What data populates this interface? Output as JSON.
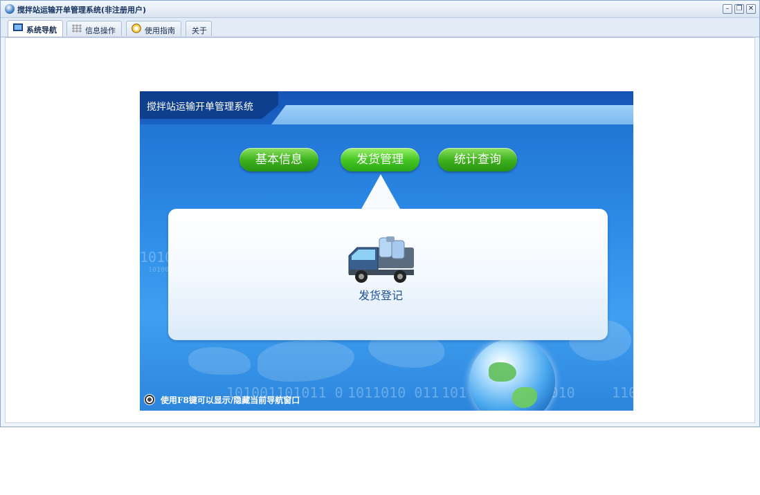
{
  "window": {
    "title": "搅拌站运输开单管理系统(非注册用户)",
    "controls": [
      "minimize",
      "restore",
      "close"
    ]
  },
  "tabs": [
    {
      "label": "系统导航",
      "icon": "monitor-icon",
      "active": true
    },
    {
      "label": "信息操作",
      "icon": "grid-icon",
      "active": false
    },
    {
      "label": "使用指南",
      "icon": "help-icon",
      "active": false
    },
    {
      "label": "关于",
      "icon": "",
      "active": false
    }
  ],
  "panel": {
    "system_title": "搅拌站运输开单管理系统",
    "menu": [
      {
        "label": "基本信息",
        "selected": false
      },
      {
        "label": "发货管理",
        "selected": true
      },
      {
        "label": "统计查询",
        "selected": false
      }
    ],
    "items": [
      {
        "label": "发货登记",
        "icon": "truck-icon"
      }
    ],
    "hint": "使用F8键可以显示/隐藏当前导航窗口",
    "decor_binary": [
      "1010",
      "10100",
      "101001101011 0",
      "1011010 011",
      "101 0110101 1010",
      "110"
    ]
  },
  "colors": {
    "accent_blue": "#1e6fd0",
    "button_green": "#3fb21e",
    "title_text": "#14315e"
  }
}
